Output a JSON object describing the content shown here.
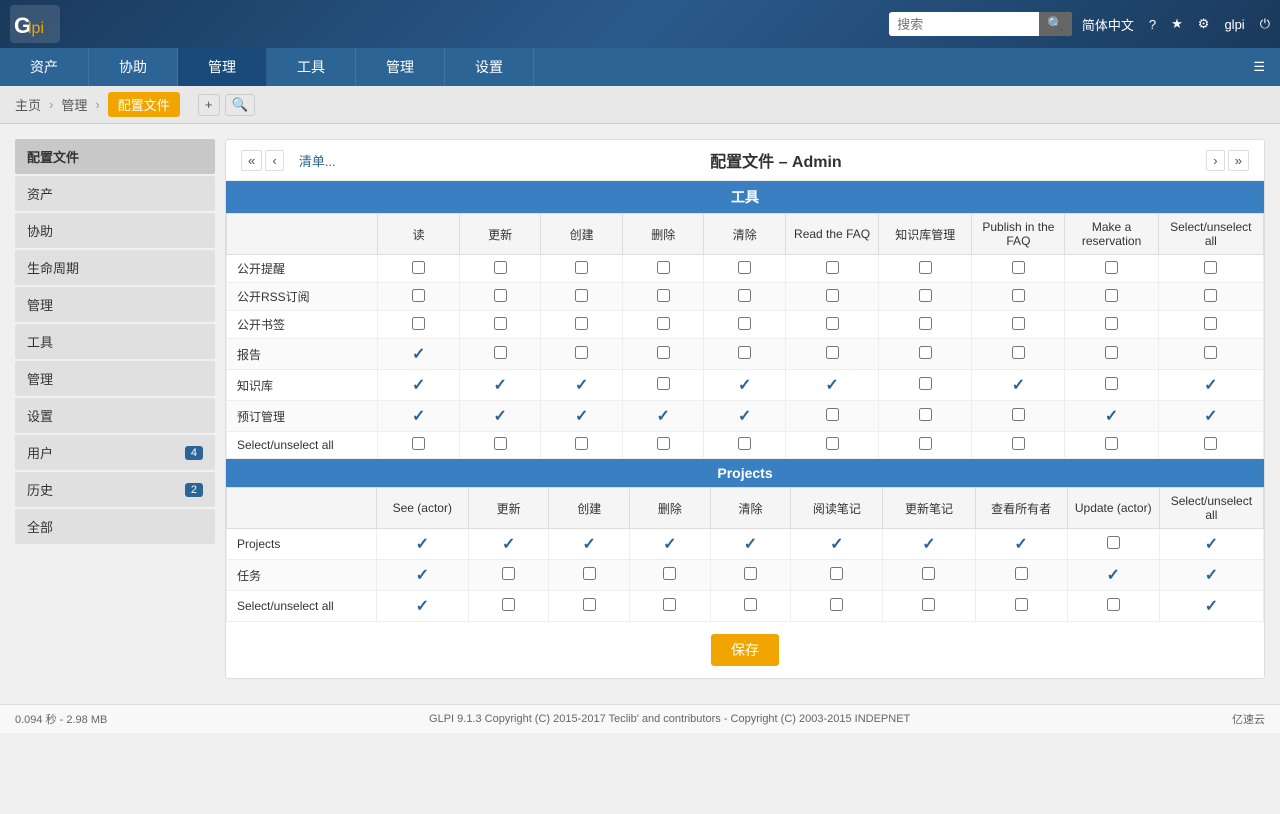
{
  "header": {
    "logo_text": "Glpi",
    "search_placeholder": "搜索",
    "lang": "简体中文",
    "help": "?",
    "user": "glpi"
  },
  "nav": {
    "items": [
      {
        "label": "资产",
        "active": false
      },
      {
        "label": "协助",
        "active": false
      },
      {
        "label": "管理",
        "active": true
      },
      {
        "label": "工具",
        "active": false
      },
      {
        "label": "管理",
        "active": false
      },
      {
        "label": "设置",
        "active": false
      }
    ]
  },
  "breadcrumb": {
    "items": [
      {
        "label": "主页",
        "active": false
      },
      {
        "label": "管理",
        "active": false
      },
      {
        "label": "配置文件",
        "active": true
      }
    ]
  },
  "page": {
    "title": "配置文件 – Admin",
    "list_link": "清单..."
  },
  "sidebar": {
    "items": [
      {
        "label": "配置文件",
        "badge": null
      },
      {
        "label": "资产",
        "badge": null
      },
      {
        "label": "协助",
        "badge": null
      },
      {
        "label": "生命周期",
        "badge": null
      },
      {
        "label": "管理",
        "badge": null
      },
      {
        "label": "工具",
        "badge": null
      },
      {
        "label": "管理",
        "badge": null
      },
      {
        "label": "设置",
        "badge": null
      },
      {
        "label": "用户",
        "badge": "4"
      },
      {
        "label": "历史",
        "badge": "2"
      },
      {
        "label": "全部",
        "badge": null
      }
    ]
  },
  "tools_section": {
    "title": "工具",
    "columns": [
      "读",
      "更新",
      "创建",
      "删除",
      "清除",
      "Read the FAQ",
      "知识库管理",
      "Publish in the FAQ",
      "Make a reservation",
      "Select/unselect all"
    ],
    "rows": [
      {
        "label": "公开提醒",
        "checks": [
          false,
          false,
          false,
          false,
          false,
          false,
          false,
          false,
          false,
          false
        ]
      },
      {
        "label": "公开RSS订阅",
        "checks": [
          false,
          false,
          false,
          false,
          false,
          false,
          false,
          false,
          false,
          false
        ]
      },
      {
        "label": "公开书签",
        "checks": [
          false,
          false,
          false,
          false,
          false,
          false,
          false,
          false,
          false,
          false
        ]
      },
      {
        "label": "报告",
        "checks": [
          true,
          false,
          false,
          false,
          false,
          false,
          false,
          false,
          false,
          false
        ]
      },
      {
        "label": "知识库",
        "checks": [
          true,
          true,
          true,
          false,
          true,
          true,
          false,
          true,
          false,
          true
        ]
      },
      {
        "label": "预订管理",
        "checks": [
          true,
          true,
          true,
          true,
          true,
          false,
          false,
          false,
          true,
          true
        ]
      },
      {
        "label": "Select/unselect all",
        "checks": [
          false,
          false,
          false,
          false,
          false,
          false,
          false,
          false,
          false,
          false
        ]
      }
    ]
  },
  "projects_section": {
    "title": "Projects",
    "columns": [
      "See (actor)",
      "更新",
      "创建",
      "删除",
      "清除",
      "阅读笔记",
      "更新笔记",
      "查看所有者",
      "Update (actor)",
      "Select/unselect all"
    ],
    "rows": [
      {
        "label": "Projects",
        "checks": [
          true,
          true,
          true,
          true,
          true,
          true,
          true,
          true,
          false,
          true
        ]
      },
      {
        "label": "任务",
        "checks": [
          true,
          false,
          false,
          false,
          false,
          false,
          false,
          false,
          true,
          true
        ]
      },
      {
        "label": "Select/unselect all",
        "checks": [
          true,
          false,
          false,
          false,
          false,
          false,
          false,
          false,
          false,
          true
        ]
      }
    ]
  },
  "save_label": "保存",
  "footer": {
    "perf": "0.094 秒 - 2.98 MB",
    "copyright": "GLPI 9.1.3 Copyright (C) 2015-2017 Teclib' and contributors - Copyright (C) 2003-2015 INDEPNET",
    "cloud_logo": "亿速云"
  }
}
